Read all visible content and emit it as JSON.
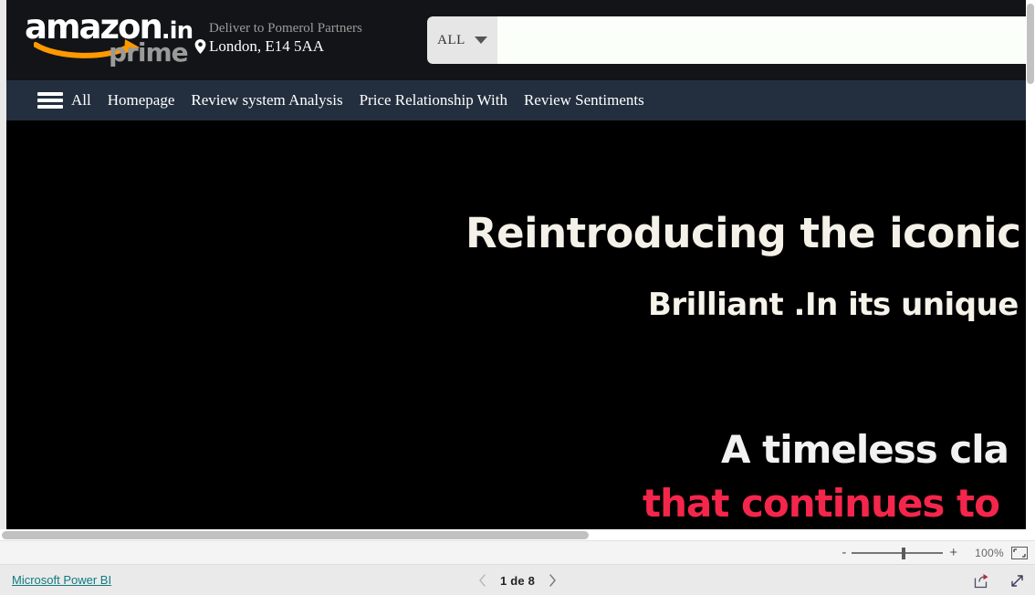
{
  "amazon_header": {
    "logo": {
      "wordmark": "amazon",
      "tld": ".in",
      "sub": "prime",
      "swoosh_color": "#ff9900",
      "wordmark_color": "#ffffff",
      "sub_color": "#9a9a9a"
    },
    "deliver": {
      "line1": "Deliver to Pomerol Partners",
      "line2": "London, E14 5AA",
      "pin_icon": "location-pin-icon"
    },
    "search": {
      "category_label": "ALL",
      "caret_icon": "chevron-down-icon",
      "value": "",
      "placeholder": ""
    },
    "background": "#131417"
  },
  "amazon_nav": {
    "background": "#232f3e",
    "burger_icon": "hamburger-menu-icon",
    "items": [
      {
        "label": "All"
      },
      {
        "label": "Homepage"
      },
      {
        "label": "Review system Analysis"
      },
      {
        "label": "Price Relationship With"
      },
      {
        "label": "Review Sentiments"
      }
    ]
  },
  "hero": {
    "background": "#000000",
    "line1": "Reintroducing the iconic A",
    "line2": "Brilliant .In its unique",
    "line3": "A timeless cla",
    "line4": "that continues to",
    "line1_color": "#f4f1e8",
    "line2_color": "#f6f3ea",
    "line3_color": "#f2f2f2",
    "line4_color": "#f5264b"
  },
  "zoombar": {
    "minus_label": "-",
    "plus_label": "+",
    "zoom_level": "100%",
    "fit_icon": "fit-to-page-icon",
    "slider_value": 55
  },
  "footer": {
    "powerbi_link": "Microsoft Power BI",
    "link_color": "#117b80",
    "pager": {
      "prev_icon": "chevron-left-icon",
      "next_icon": "chevron-right-icon",
      "page_text": "1 de 8"
    },
    "tools": [
      {
        "icon": "share-icon"
      },
      {
        "icon": "fullscreen-expand-icon"
      }
    ]
  },
  "scrollbars": {
    "vertical_icon": "vertical-scrollbar",
    "horizontal_icon": "horizontal-scrollbar"
  }
}
